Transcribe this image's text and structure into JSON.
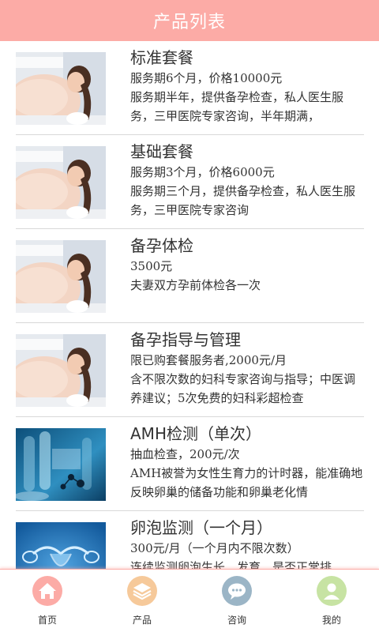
{
  "header": {
    "title": "产品列表"
  },
  "products": [
    {
      "title": "标准套餐",
      "price": "服务期6个月，价格10000元",
      "desc": "服务期半年，提供备孕检查，私人医生服务，三甲医院专家咨询，半年期满，",
      "image": "pregnant-mother-child-photo"
    },
    {
      "title": "基础套餐",
      "price": "服务期3个月，价格6000元",
      "desc": "服务期三个月，提供备孕检查，私人医生服务，三甲医院专家咨询",
      "image": "pregnant-mother-child-photo"
    },
    {
      "title": "备孕体检",
      "price": "3500元",
      "desc": "夫妻双方孕前体检各一次",
      "image": "pregnant-mother-child-photo"
    },
    {
      "title": "备孕指导与管理",
      "price": "限已购套餐服务者,2000元/月",
      "desc": "含不限次数的妇科专家咨询与指导；中医调养建议；5次免费的妇科彩超检查",
      "image": "pregnant-mother-child-photo"
    },
    {
      "title": "AMH检测（单次）",
      "price": "抽血检查，200元/次",
      "desc": "AMH被誉为女性生育力的计时器，能准确地反映卵巢的储备功能和卵巢老化情",
      "image": "lab-test-tubes-photo"
    },
    {
      "title": "卵泡监测（一个月）",
      "price": "300元/月（一个月内不限次数）",
      "desc": "连续监测卵泡生长、发育、是否正常排",
      "image": "uterus-illustration"
    }
  ],
  "tabbar": [
    {
      "label": "首页",
      "icon": "home-icon",
      "color": "#fcaba6"
    },
    {
      "label": "产品",
      "icon": "layers-icon",
      "color": "#f6c99a"
    },
    {
      "label": "咨询",
      "icon": "chat-icon",
      "color": "#9bb5c6"
    },
    {
      "label": "我的",
      "icon": "user-icon",
      "color": "#c7e3a3"
    }
  ]
}
